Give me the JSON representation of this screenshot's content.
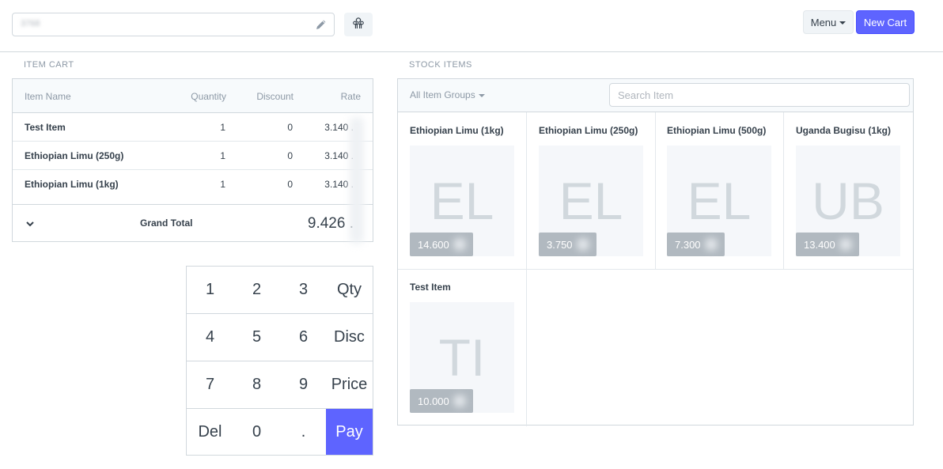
{
  "topbar": {
    "customer_value": "3768",
    "menu_label": "Menu",
    "new_cart_label": "New Cart"
  },
  "cart": {
    "section_label": "ITEM CART",
    "headers": {
      "name": "Item Name",
      "qty": "Quantity",
      "discount": "Discount",
      "rate": "Rate"
    },
    "rows": [
      {
        "name": "Test Item",
        "qty": "1",
        "discount": "0",
        "rate": "3.140 ."
      },
      {
        "name": "Ethiopian Limu (250g)",
        "qty": "1",
        "discount": "0",
        "rate": "3.140 ."
      },
      {
        "name": "Ethiopian Limu (1kg)",
        "qty": "1",
        "discount": "0",
        "rate": "3.140 ."
      }
    ],
    "grand_total_label": "Grand Total",
    "grand_total_value": "9.426 ."
  },
  "numpad": {
    "keys": [
      "1",
      "2",
      "3",
      "Qty",
      "4",
      "5",
      "6",
      "Disc",
      "7",
      "8",
      "9",
      "Price",
      "Del",
      "0",
      ".",
      "Pay"
    ]
  },
  "stock": {
    "section_label": "STOCK ITEMS",
    "group_filter_label": "All Item Groups",
    "search_placeholder": "Search Item",
    "items": [
      {
        "name": "Ethiopian Limu (1kg)",
        "abbr": "EL",
        "price": "14.600"
      },
      {
        "name": "Ethiopian Limu (250g)",
        "abbr": "EL",
        "price": "3.750"
      },
      {
        "name": "Ethiopian Limu (500g)",
        "abbr": "EL",
        "price": "7.300"
      },
      {
        "name": "Uganda Bugisu (1kg)",
        "abbr": "UB",
        "price": "13.400"
      },
      {
        "name": "Test Item",
        "abbr": "TI",
        "price": "10.000"
      }
    ]
  },
  "colors": {
    "primary": "#5e64ff",
    "border": "#d1d8dd",
    "muted_text": "#8d99a6",
    "price_tag": "#b1b9c0"
  }
}
